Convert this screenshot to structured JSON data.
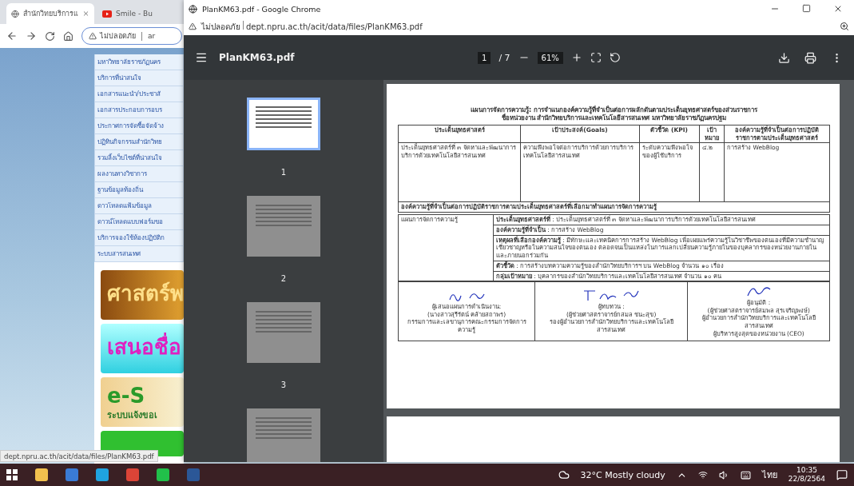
{
  "back_window": {
    "tabs": [
      {
        "title": "สำนักวิทยบริการแ",
        "kind": "globe",
        "selected": true
      },
      {
        "title": "Smile - Bu",
        "kind": "video",
        "selected": false
      }
    ],
    "address": {
      "warning": "ไม่ปลอดภัย",
      "url": "ar"
    },
    "menu": [
      "มหาวิทยาลัยราชภัฏนคร",
      "บริการที่น่าสนใจ",
      "เอกสารแนะนำ/ประชาสั",
      "เอกสารประกอบการอบร",
      "ประกาศการจัดซื้อจัดจ้าง",
      "ปฏิทินกิจกรรมสำนักวิทย",
      "รวมลิ้งเว็บไซต์ที่น่าสนใจ",
      "ผลงานทางวิชาการ",
      "ฐานข้อมูลท้องถิ่น",
      "ดาวโหลดแฟ้มข้อมูล",
      "ดาวน์โหลดแบบฟอร์มขอ",
      "บริการจองใช้ห้องปฏิบัติก",
      "ระบบสารสนเทศ"
    ],
    "banners": [
      {
        "kind": "gold",
        "text": "ศาสตร์พ"
      },
      {
        "kind": "cyan",
        "text": "เสนอชื่อ"
      },
      {
        "kind": "service",
        "text": "e-S",
        "subtext": "ระบบแจ้งขอเ"
      },
      {
        "kind": "green"
      }
    ],
    "status_url": "dept.npru.ac.th/acit/data/files/PlanKM63.pdf"
  },
  "pdf_window": {
    "title": "PlanKM63.pdf - Google Chrome",
    "warning": "ไม่ปลอดภัย",
    "url": "dept.npru.ac.th/acit/data/files/PlanKM63.pdf",
    "toolbar": {
      "filename": "PlanKM63.pdf",
      "page": "1",
      "total": "/ 7",
      "zoom": "61%"
    },
    "thumbnails": [
      {
        "label": "1",
        "selected": true
      },
      {
        "label": "2",
        "selected": false
      },
      {
        "label": "3",
        "selected": false
      },
      {
        "selected": false
      }
    ],
    "document": {
      "title": "แผนการจัดการความรู้: การจำแนกองค์ความรู้ที่จำเป็นต่อการผลักดันตามประเด็นยุทธศาสตร์ของส่วนราชการ",
      "subtitle": "ชื่อหน่วยงาน สำนักวิทยบริการและเทคโนโลยีสารสนเทศ มหาวิทยาลัยราชภัฏนครปฐม",
      "columns": [
        "ประเด็นยุทธศาสตร์",
        "เป้าประสงค์(Goals)",
        "ตัวชี้วัด (KPI)",
        "เป้าหมาย",
        "องค์ความรู้ที่จำเป็นต่อการปฏิบัติราชการตามประเด็นยุทธศาสตร์"
      ],
      "row": [
        "ประเด็นยุทธศาสตร์ที่ ๓ จัดหาและพัฒนาการบริการด้วยเทคโนโลยีสารสนเทศ",
        "ความพึงพอใจต่อการบริการด้วยการบริการเทคโนโลยีสารสนเทศ",
        "ระดับความพึงพอใจของผู้ใช้บริการ",
        "๔.๒",
        "การสร้าง WebBlog"
      ],
      "section": "องค์ความรู้ที่จำเป็นต่อการปฏิบัติราชการตามประเด็นยุทธศาสตร์ที่เลือกมาทำแผนการจัดการความรู้",
      "plan": "แผนการจัดการความรู้",
      "details": [
        "**ประเด็นยุทธศาสตร์ที่** : ประเด็นยุทธศาสตร์ที่ ๓ จัดหาและพัฒนาการบริการด้วยเทคโนโลยีสารสนเทศ",
        "**องค์ความรู้ที่จำเป็น** : การสร้าง WebBlog",
        "**เหตุผลที่เลือกองค์ความรู้** : มีทักษะและเทคนิคการการสร้าง WebBlog เพื่อเผยแพร่ความรู้ในวิชาชีพของตนเองที่มีความชำนาญ เชี่ยวชาญหรือในความสนใจของตนเอง ตลอดจนเป็นแหล่งในการแลกเปลี่ยนความรู้ภายในของบุคลากรของหน่วยงานภายในและภายนอกร่วมกัน",
        "**ตัวชี้วัด** : การสร้างบทความความรู้ของสำนักวิทยบริการฯ บน WebBlog จำนวน ๑๐ เรื่อง",
        "**กลุ่มเป้าหมาย** : บุคลากรของสำนักวิทยบริการและเทคโนโลยีสารสนเทศ จำนวน ๑๐ คน"
      ],
      "signatures": [
        {
          "role": "ผู้เสนอแผนการดำเนินงาน:",
          "lines": [
            "(นางสาวสุรีรัตน์ คล้ายสถาพร)",
            "กรรมการและเลขานุการคณะกรรมการจัดการความรู้"
          ]
        },
        {
          "role": "ผู้ทบทวน :",
          "lines": [
            "(ผู้ช่วยศาสตราจารย์กสมล ชนะสุข)",
            "รองผู้อำนวยการสำนักวิทยบริการและเทคโนโลยีสารสนเทศ"
          ]
        },
        {
          "role": "ผู้อนุมัติ :",
          "lines": [
            "(ผู้ช่วยศาสตราจารย์สมพล สุรเจริญพงษ์)",
            "ผู้อำนวยการสำนักวิทยบริการและเทคโนโลยีสารสนเทศ",
            "ผู้บริหารสูงสุดของหน่วยงาน (CEO)"
          ]
        }
      ]
    }
  },
  "taskbar": {
    "weather": "32°C Mostly cloudy",
    "language": "ไทย",
    "time": "10:35",
    "date": "22/8/2564"
  }
}
